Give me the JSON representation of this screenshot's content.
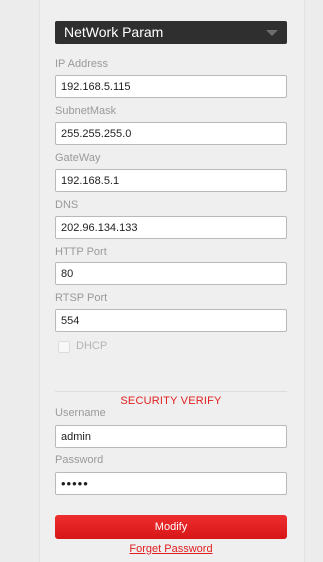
{
  "network": {
    "selector_value": "NetWork Param",
    "ip_label": "IP Address",
    "ip_value": "192.168.5.115",
    "subnet_label": "SubnetMask",
    "subnet_value": "255.255.255.0",
    "gateway_label": "GateWay",
    "gateway_value": "192.168.5.1",
    "dns_label": "DNS",
    "dns_value": "202.96.134.133",
    "http_label": "HTTP Port",
    "http_value": "80",
    "rtsp_label": "RTSP Port",
    "rtsp_value": "554",
    "dhcp_label": "DHCP",
    "dhcp_checked": false
  },
  "security": {
    "title": "SECURITY VERIFY",
    "username_label": "Username",
    "username_value": "admin",
    "password_label": "Password",
    "password_value": "•••••",
    "modify_label": "Modify",
    "forget_label": "Forget Password"
  },
  "colors": {
    "accent": "#e02121",
    "selector_bg": "#2f2f2f"
  },
  "icons": {
    "selector_caret": "chevron-down-icon"
  }
}
